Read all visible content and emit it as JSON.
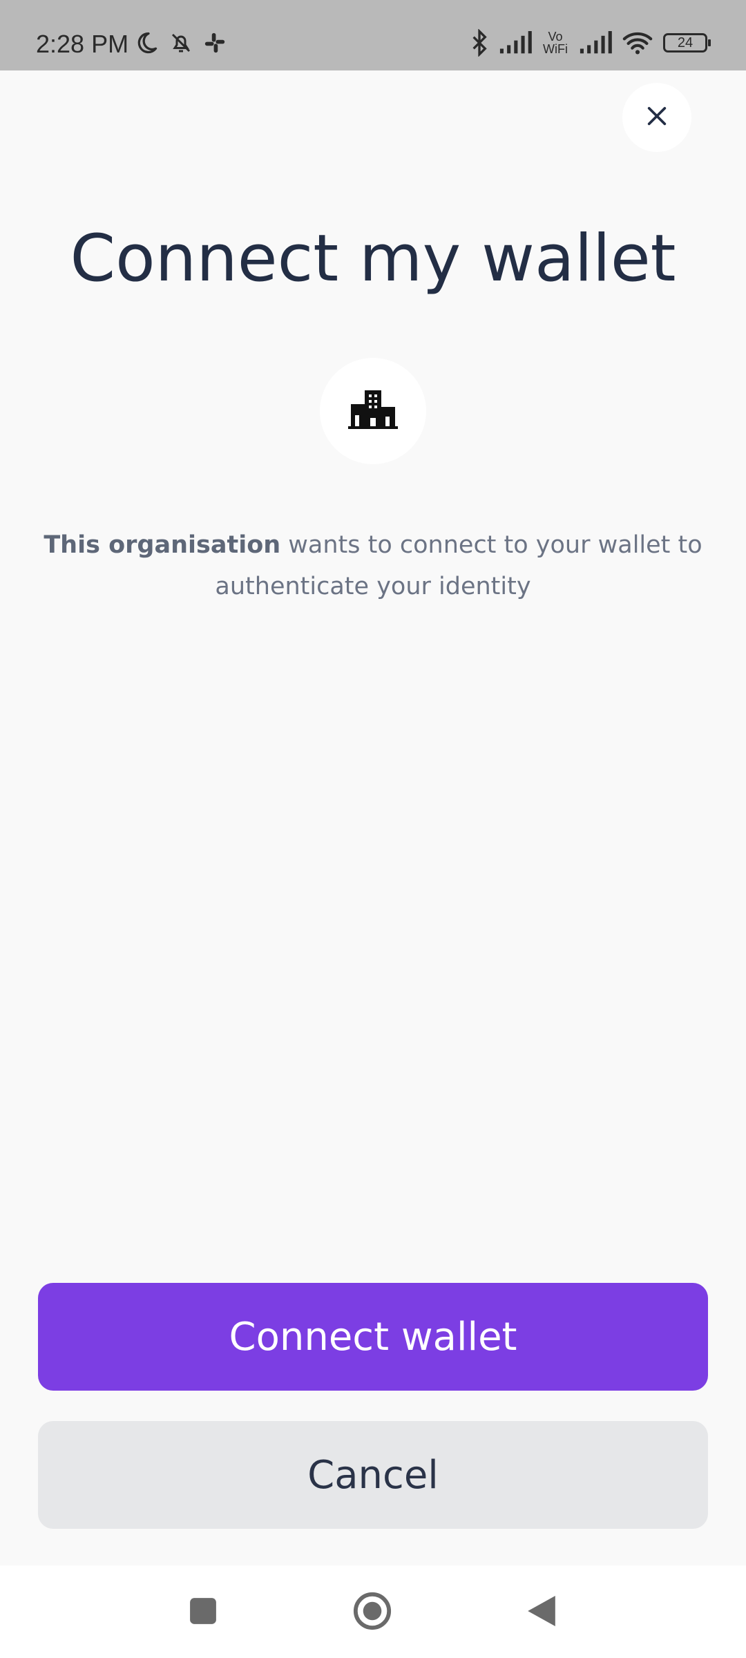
{
  "status_bar": {
    "time": "2:28 PM",
    "icons_left": [
      "moon-icon",
      "bell-off-icon",
      "slack-icon"
    ],
    "icons_right": [
      "bluetooth-icon",
      "signal-icon",
      "vowifi-icon",
      "signal-icon",
      "wifi-icon",
      "battery-icon"
    ],
    "vowifi_top": "Vo",
    "vowifi_bottom": "WiFi",
    "battery_level": "24"
  },
  "dialog": {
    "close_icon": "close-icon",
    "title": "Connect my wallet",
    "org_icon": "building-icon",
    "description_bold": "This organisation",
    "description_rest": " wants to connect to your wallet to authenticate your identity"
  },
  "actions": {
    "connect_label": "Connect wallet",
    "cancel_label": "Cancel"
  },
  "colors": {
    "accent": "#7c3ee3",
    "title_text": "#232e45",
    "body_text": "#6b7384",
    "cancel_bg": "#e6e7e9"
  },
  "nav_bar": {
    "buttons": [
      "recents-icon",
      "home-icon",
      "back-icon"
    ]
  }
}
